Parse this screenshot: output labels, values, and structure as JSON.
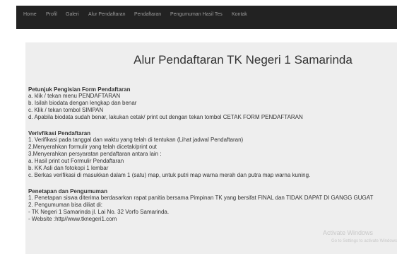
{
  "nav": {
    "items": [
      "Home",
      "Profil",
      "Galeri",
      "Alur Pendaftaran",
      "Pendaftaran",
      "Pengumuman Hasil Tes",
      "Kontak"
    ]
  },
  "content": {
    "title": "Alur Pendaftaran TK Negeri 1 Samarinda",
    "sections": [
      {
        "heading": "Petunjuk Pengisian Form Pendaftaran",
        "lines": [
          " a. klik / tekan menu PENDAFTARAN",
          " b. Isilah biodata dengan lengkap dan benar",
          " c. Klik / tekan tombol SIMPAN",
          " d. Apabila biodata sudah benar, lakukan cetak/ print out dengan tekan tombol CETAK FORM PENDAFTARAN"
        ]
      },
      {
        "heading": "Verivfikasi Pendaftaran",
        "lines": [
          " 1. Verifikasi pada tanggal dan waktu yang telah di tentukan (Lihat jadwal Pendaftaran)",
          " 2.Menyerahkan formulir yang telah dicetak/print out",
          " 3.Menyerahkan persyaratan pendaftaran antara lain :",
          "  a. Hasil print out Formulir Pendaftaran",
          "  b. KK Asli dan fotokopi 1 lembar",
          "  c. Berkas verifikasi di masukkan dalam 1 (satu) map, untuk putri map warna merah dan putra map warna kuning."
        ]
      },
      {
        "heading": "Penetapan dan Pengumuman",
        "lines": [
          " 1. Penetapan siswa diterima berdasarkan rapat panitia bersama Pimpinan TK yang bersifat FINAL dan TIDAK DAPAT DI GANGG GUGAT",
          "  2. Pengumuman bisa diliat di:",
          "      - TK Negeri 1 Samarinda jl. Lai No. 32 Vorfo Samarinda.",
          "      - Website :http//www.tknegeri1.com"
        ]
      }
    ]
  },
  "watermark": {
    "title": "Activate Windows",
    "subtitle": "Go to Settings to activate Windows"
  }
}
